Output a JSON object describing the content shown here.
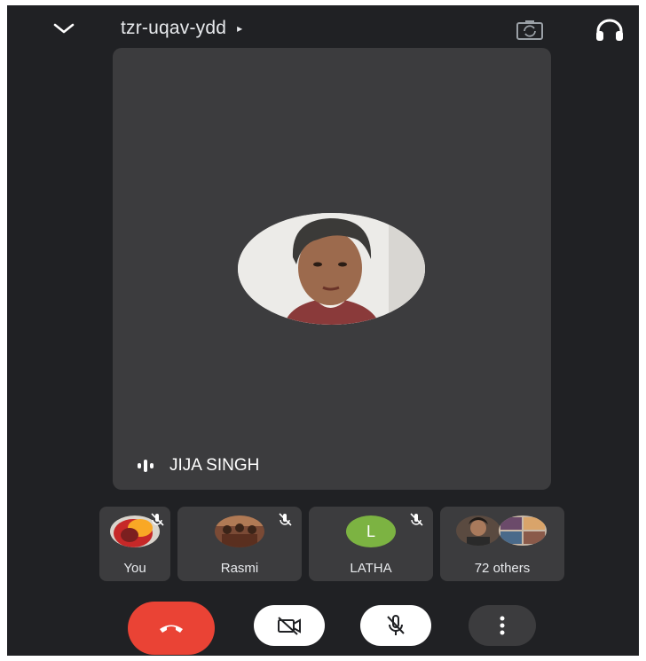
{
  "header": {
    "meeting_code": "tzr-uqav-ydd",
    "code_arrow": "▸"
  },
  "main_participant": {
    "name": "JIJA SINGH"
  },
  "participants": [
    {
      "label": "You",
      "muted": true
    },
    {
      "label": "Rasmi",
      "muted": true
    },
    {
      "label": "LATHA",
      "initial": "L",
      "avatar_color": "#7cb342",
      "muted": true
    },
    {
      "label": "72 others"
    }
  ],
  "colors": {
    "background": "#202124",
    "tile": "#3c3c3e",
    "end_call": "#ea4335"
  }
}
